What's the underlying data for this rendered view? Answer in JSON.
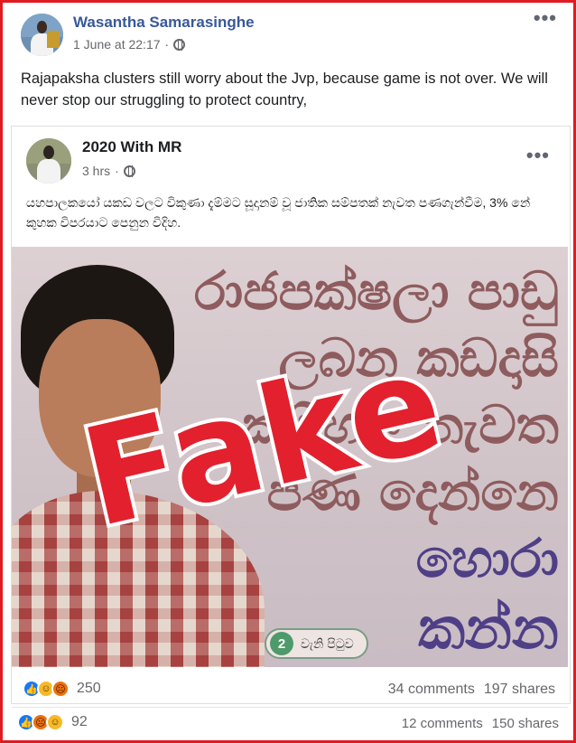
{
  "outer_post": {
    "author": "Wasantha Samarasinghe",
    "timestamp": "1 June at 22:17",
    "text": "Rajapaksha clusters still worry about the Jvp, because game is not over. We will never stop our struggling to protect country,",
    "menu_label": "•••",
    "reactions": {
      "icons": [
        "like-icon",
        "angry-icon",
        "haha-icon"
      ],
      "count": "92"
    },
    "comments": "12 comments",
    "shares": "150 shares"
  },
  "shared_post": {
    "author": "2020 With MR",
    "timestamp": "3 hrs",
    "menu_label": "•••",
    "text": "යහපාලකයෝ යකඩ වලට විකුණා දැම්මට සූදානම් වූ ජාතික සම්පතක් නැවත පණගැන්වීම, 3% නේ කුහක විපරයාට පෙනුන විදිහ.",
    "image": {
      "headline_lines": [
        "රාජපක්ෂලා පාඩු",
        "ලබන කඩදාසි",
        "කම්හල නැවත",
        "පණ දෙන්නෙ",
        "හොරා",
        "කන්න"
      ],
      "page_badge_number": "2",
      "page_badge_text": "වැනි පිටුව",
      "stamp": "Fake"
    },
    "reactions": {
      "icons": [
        "like-icon",
        "haha-icon",
        "angry-icon"
      ],
      "count": "250"
    },
    "comments": "34 comments",
    "shares": "197 shares"
  },
  "colors": {
    "frame_border": "#e01b22",
    "author_link": "#385898",
    "stamp_red": "#e3202d",
    "headline_brown": "#8e5c5e",
    "headline_purple": "#4f3f86"
  }
}
